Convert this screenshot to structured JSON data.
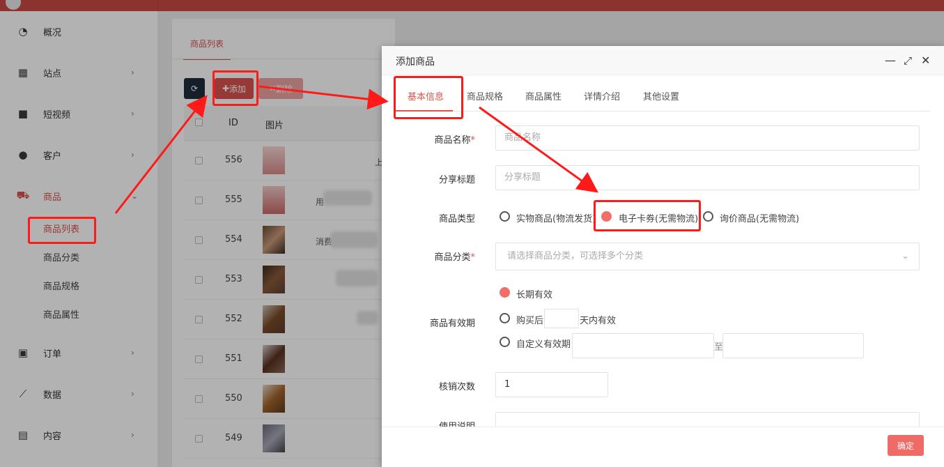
{
  "sidebar": {
    "items": [
      {
        "label": "概况",
        "icon": "dashboard-icon",
        "chevron": ""
      },
      {
        "label": "站点",
        "icon": "grid-icon",
        "chevron": "›"
      },
      {
        "label": "短视频",
        "icon": "video-icon",
        "chevron": "›"
      },
      {
        "label": "客户",
        "icon": "users-icon",
        "chevron": "›"
      },
      {
        "label": "商品",
        "icon": "cart-icon",
        "chevron": "⌄"
      },
      {
        "label": "订单",
        "icon": "money-icon",
        "chevron": "›"
      },
      {
        "label": "数据",
        "icon": "chart-icon",
        "chevron": "›"
      },
      {
        "label": "内容",
        "icon": "document-icon",
        "chevron": "›"
      }
    ],
    "sub_items": [
      "商品列表",
      "商品分类",
      "商品规格",
      "商品属性"
    ]
  },
  "list": {
    "tab": "商品列表",
    "add_label": "添加",
    "delete_label": "删除",
    "columns": {
      "id": "ID",
      "image": "图片"
    },
    "rows": [
      {
        "id": "556",
        "text": "上"
      },
      {
        "id": "555",
        "text": "用"
      },
      {
        "id": "554",
        "text": "消费"
      },
      {
        "id": "553",
        "text": ""
      },
      {
        "id": "552",
        "text": ""
      },
      {
        "id": "551",
        "text": ""
      },
      {
        "id": "550",
        "text": ""
      },
      {
        "id": "549",
        "text": ""
      }
    ]
  },
  "modal": {
    "title": "添加商品",
    "tabs": [
      "基本信息",
      "商品规格",
      "商品属性",
      "详情介绍",
      "其他设置"
    ],
    "fields": {
      "name_label": "商品名称",
      "name_placeholder": "商品名称",
      "share_label": "分享标题",
      "share_placeholder": "分享标题",
      "type_label": "商品类型",
      "type_options": [
        "实物商品(物流发货)",
        "电子卡券(无需物流)",
        "询价商品(无需物流)"
      ],
      "category_label": "商品分类",
      "category_placeholder": "请选择商品分类，可选择多个分类",
      "validity_label": "商品有效期",
      "validity_long": "长期有效",
      "validity_after": "购买后",
      "validity_days": "天内有效",
      "validity_custom": "自定义有效期",
      "validity_to": "至",
      "verify_label": "核销次数",
      "verify_value": "1",
      "usage_label": "使用说明"
    },
    "confirm_label": "确定"
  },
  "colors": {
    "accent": "#d9534f",
    "highlight": "#ff1a1a",
    "topbar": "#c94a45"
  }
}
